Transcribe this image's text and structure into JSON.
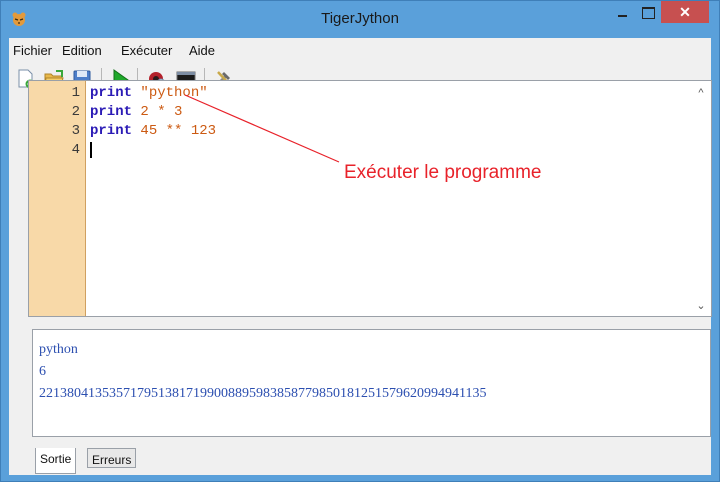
{
  "window": {
    "title": "TigerJython",
    "minimize_icon": "minimize-icon",
    "maximize_icon": "maximize-icon",
    "close_label": "✕"
  },
  "menu": {
    "items": [
      "Fichier",
      "Edition",
      "Exécuter",
      "Aide"
    ]
  },
  "toolbar": {
    "icons": [
      "new-file-icon",
      "open-file-icon",
      "save-icon",
      "run-icon",
      "debug-icon",
      "console-icon",
      "tools-icon"
    ]
  },
  "editor": {
    "line_numbers": [
      "1",
      "2",
      "3",
      "4"
    ],
    "lines": [
      {
        "keyword": "print",
        "rest": " \"python\""
      },
      {
        "keyword": "print",
        "rest": " 2 * 3"
      },
      {
        "keyword": "print",
        "rest": " 45 ** 123"
      }
    ]
  },
  "annotation": {
    "text": "Exécuter le programme",
    "color": "#e8222a"
  },
  "output": {
    "lines": [
      "python",
      "6",
      "2213804135357179513817199008895983858779850181251579620994941135"
    ]
  },
  "tabs": [
    "Sortie",
    "Erreurs"
  ],
  "colors": {
    "titlebar": "#5aa0da",
    "gutter": "#f8d9a8",
    "keyword": "#2a1ab5",
    "literal": "#cc5a12",
    "output_text": "#2c4fb0"
  }
}
